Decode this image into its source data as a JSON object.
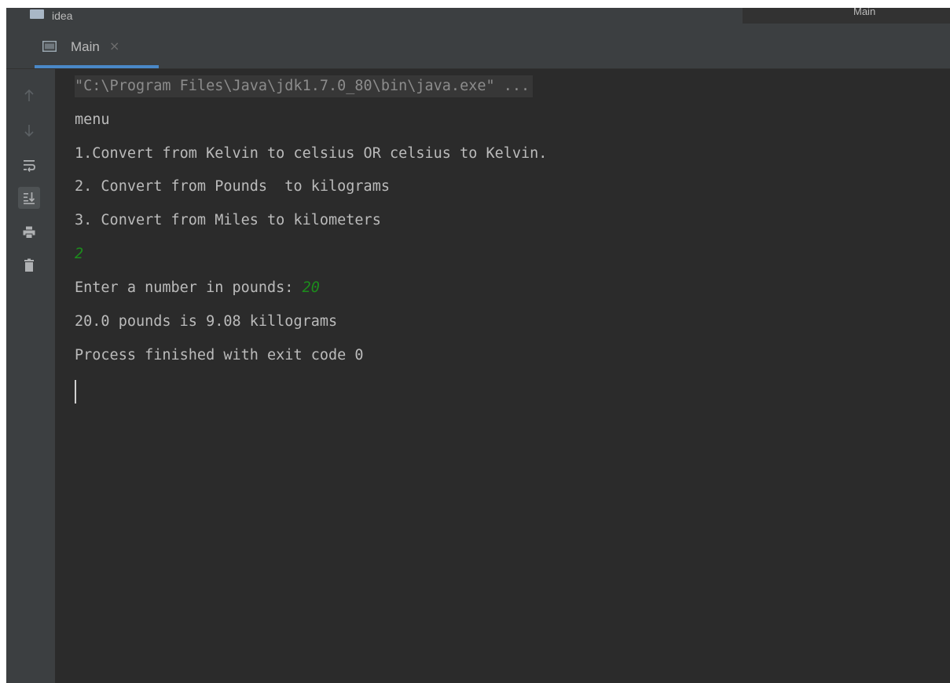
{
  "breadcrumb": {
    "folder_icon": "folder-icon",
    "label": "idea",
    "right_label": "Main"
  },
  "run_tab": {
    "icon": "console-window-icon",
    "label": "Main",
    "close_glyph": "×"
  },
  "gutter": {
    "buttons": [
      {
        "name": "scroll-up-icon",
        "glyph": "↑"
      },
      {
        "name": "scroll-down-icon",
        "glyph": "↓"
      },
      {
        "name": "soft-wrap-icon",
        "glyph": "wrap"
      },
      {
        "name": "scroll-to-end-icon",
        "glyph": "scroll-end",
        "active": true
      },
      {
        "name": "print-icon",
        "glyph": "print"
      },
      {
        "name": "trash-icon",
        "glyph": "trash"
      }
    ]
  },
  "console": {
    "command_line": "\"C:\\Program Files\\Java\\jdk1.7.0_80\\bin\\java.exe\" ...",
    "line_menu": "menu",
    "line_opt1": "1.Convert from Kelvin to celsius OR celsius to Kelvin.",
    "line_opt2": "2. Convert from Pounds  to kilograms",
    "line_opt3": "3. Convert from Miles to kilometers",
    "user_choice": "2",
    "prompt": "Enter a number in pounds: ",
    "prompt_input": "20",
    "result": "20.0 pounds is 9.08 killograms",
    "exit_message": "Process finished with exit code 0"
  },
  "colors": {
    "background": "#2b2b2b",
    "panel": "#3c3f41",
    "text": "#bbbbbb",
    "user_input": "#1c8c1c",
    "tab_accent": "#4a88c7"
  }
}
